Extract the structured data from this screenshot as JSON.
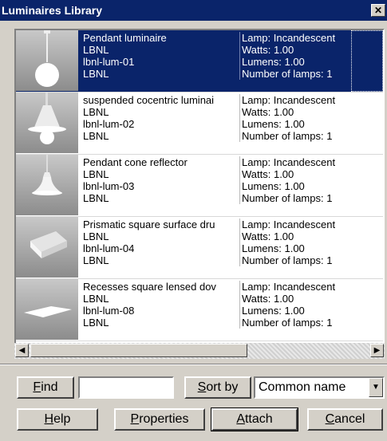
{
  "window": {
    "title": "Luminaires Library",
    "close_glyph": "✕"
  },
  "luminaires": [
    {
      "name": "Pendant luminaire",
      "manufacturer": "LBNL",
      "id": "lbnl-lum-01",
      "catalog": "LBNL",
      "lamp": "Lamp: Incandescent",
      "watts": "Watts: 1.00",
      "lumens": "Lumens: 1.00",
      "num_lamps": "Number of lamps: 1",
      "selected": true,
      "icon": "pendant-globe-icon"
    },
    {
      "name": "suspended cocentric luminai",
      "manufacturer": "LBNL",
      "id": "lbnl-lum-02",
      "catalog": "LBNL",
      "lamp": "Lamp: Incandescent",
      "watts": "Watts: 1.00",
      "lumens": "Lumens: 1.00",
      "num_lamps": "Number of lamps: 1",
      "selected": false,
      "icon": "concentric-luminaire-icon"
    },
    {
      "name": "Pendant cone reflector",
      "manufacturer": "LBNL",
      "id": "lbnl-lum-03",
      "catalog": "LBNL",
      "lamp": "Lamp: Incandescent",
      "watts": "Watts: 1.00",
      "lumens": "Lumens: 1.00",
      "num_lamps": "Number of lamps: 1",
      "selected": false,
      "icon": "cone-reflector-icon"
    },
    {
      "name": "Prismatic square surface dru",
      "manufacturer": "LBNL",
      "id": "lbnl-lum-04",
      "catalog": "LBNL",
      "lamp": "Lamp: Incandescent",
      "watts": "Watts: 1.00",
      "lumens": "Lumens: 1.00",
      "num_lamps": "Number of lamps: 1",
      "selected": false,
      "icon": "square-drum-icon"
    },
    {
      "name": "Recesses square lensed dov",
      "manufacturer": "LBNL",
      "id": "lbnl-lum-08",
      "catalog": "LBNL",
      "lamp": "Lamp: Incandescent",
      "watts": "Watts: 1.00",
      "lumens": "Lumens: 1.00",
      "num_lamps": "Number of lamps: 1",
      "selected": false,
      "icon": "recessed-lensed-icon"
    }
  ],
  "scrollbar": {
    "left_arrow": "◀",
    "right_arrow": "▶"
  },
  "find": {
    "label_access": "F",
    "label_rest": "ind",
    "value": ""
  },
  "sort": {
    "label_access": "S",
    "label_rest": "ort by",
    "selected": "Common name",
    "arrow": "▼"
  },
  "buttons": {
    "help": {
      "access": "H",
      "rest": "elp"
    },
    "properties": {
      "access": "P",
      "rest": "roperties"
    },
    "attach": {
      "access": "A",
      "rest": "ttach"
    },
    "cancel": {
      "access": "C",
      "rest": "ancel"
    }
  },
  "colors": {
    "selection": "#0a246a",
    "titlebar": "#0a246a",
    "face": "#d4d0c8"
  }
}
